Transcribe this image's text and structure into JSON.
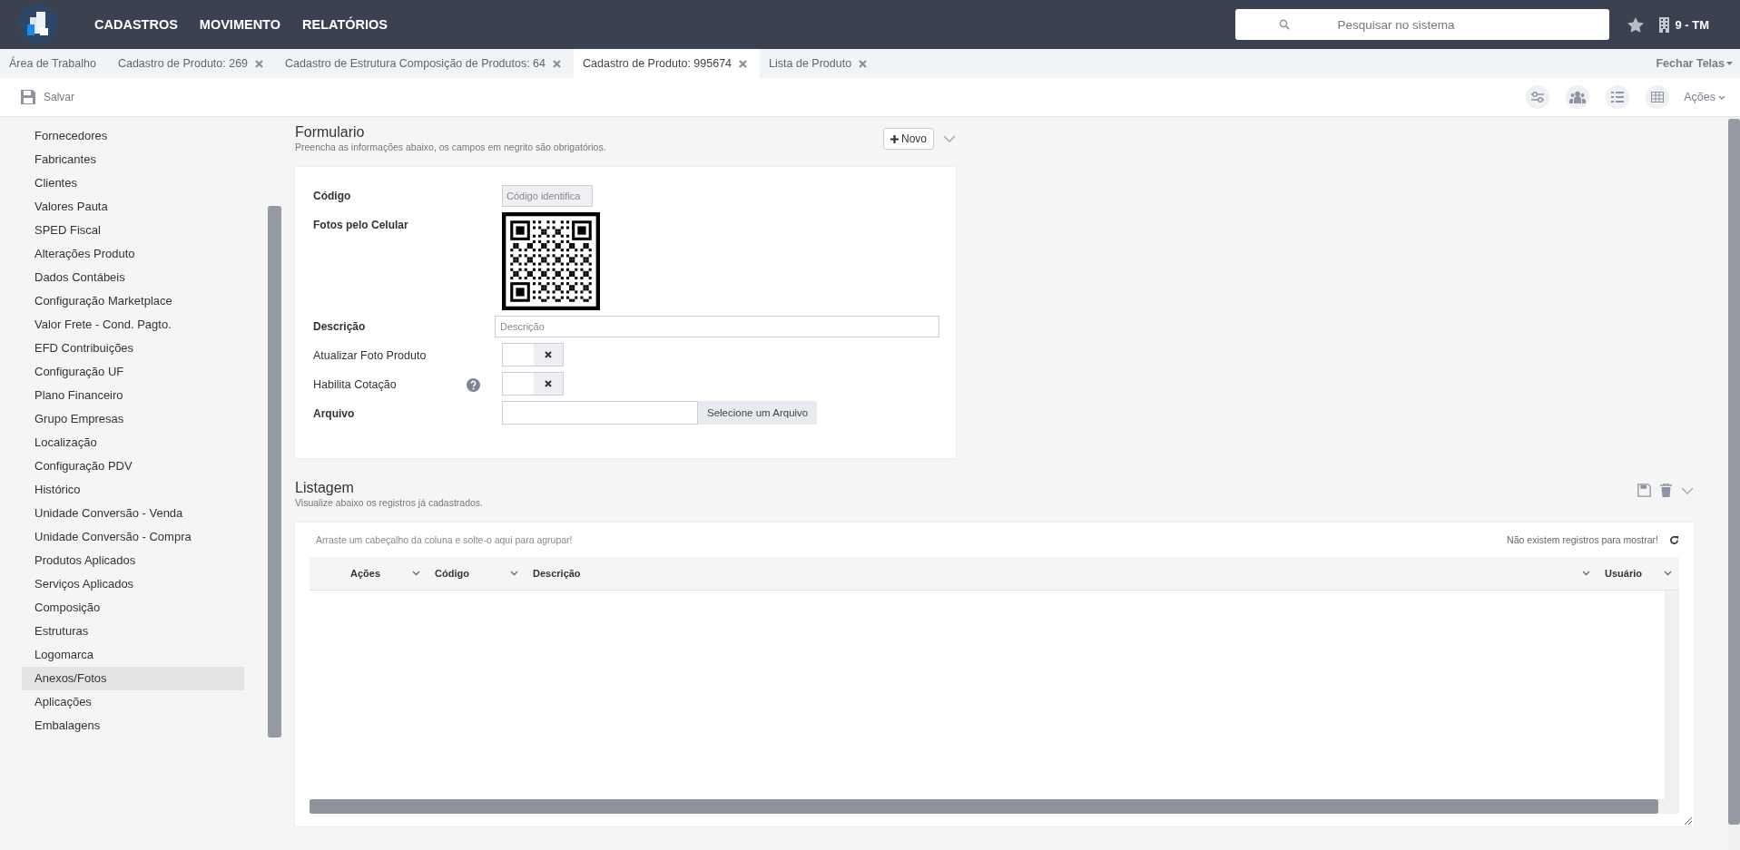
{
  "header": {
    "menu": [
      {
        "label": "CADASTROS"
      },
      {
        "label": "MOVIMENTO"
      },
      {
        "label": "RELATÓRIOS"
      }
    ],
    "search": {
      "placeholder": "Pesquisar no sistema"
    },
    "company": "9 - TM"
  },
  "tabs": [
    {
      "label": "Área de Trabalho",
      "selected": false,
      "closable": false
    },
    {
      "label": "Cadastro de Produto: 269",
      "selected": false,
      "closable": true
    },
    {
      "label": "Cadastro de Estrutura Composição de Produtos: 64",
      "selected": false,
      "closable": true
    },
    {
      "label": "Cadastro de Produto: 995674",
      "selected": true,
      "closable": true
    },
    {
      "label": "Lista de Produto",
      "selected": false,
      "closable": true
    }
  ],
  "close_screens": "Fechar Telas",
  "toolbar": {
    "save": "Salvar",
    "actions": "Ações"
  },
  "sidebar": {
    "items": [
      {
        "label": "Fornecedores",
        "selected": false
      },
      {
        "label": "Fabricantes",
        "selected": false
      },
      {
        "label": "Clientes",
        "selected": false
      },
      {
        "label": "Valores Pauta",
        "selected": false
      },
      {
        "label": "SPED Fiscal",
        "selected": false
      },
      {
        "label": "Alterações Produto",
        "selected": false
      },
      {
        "label": "Dados Contábeis",
        "selected": false
      },
      {
        "label": "Configuração Marketplace",
        "selected": false
      },
      {
        "label": "Valor Frete - Cond. Pagto.",
        "selected": false
      },
      {
        "label": "EFD Contribuições",
        "selected": false
      },
      {
        "label": "Configuração UF",
        "selected": false
      },
      {
        "label": "Plano Financeiro",
        "selected": false
      },
      {
        "label": "Grupo Empresas",
        "selected": false
      },
      {
        "label": "Localização",
        "selected": false
      },
      {
        "label": "Configuração PDV",
        "selected": false
      },
      {
        "label": "Histórico",
        "selected": false
      },
      {
        "label": "Unidade Conversão - Venda",
        "selected": false
      },
      {
        "label": "Unidade Conversão - Compra",
        "selected": false
      },
      {
        "label": "Produtos Aplicados",
        "selected": false
      },
      {
        "label": "Serviços Aplicados",
        "selected": false
      },
      {
        "label": "Composição",
        "selected": false
      },
      {
        "label": "Estruturas",
        "selected": false
      },
      {
        "label": "Logomarca",
        "selected": false
      },
      {
        "label": "Anexos/Fotos",
        "selected": true
      },
      {
        "label": "Aplicações",
        "selected": false
      },
      {
        "label": "Embalagens",
        "selected": false
      }
    ]
  },
  "form": {
    "title": "Formulario",
    "subtitle": "Preencha as informações abaixo, os campos em negrito são obrigatórios.",
    "new_button": "Novo",
    "fields": [
      {
        "kind": "text",
        "label": "Código",
        "required": true,
        "placeholder": "Código identifica",
        "short": true
      },
      {
        "kind": "qr",
        "label": "Fotos pelo Celular",
        "required": true
      },
      {
        "kind": "text",
        "label": "Descrição",
        "required": true,
        "placeholder": "Descrição",
        "short": false
      },
      {
        "kind": "toggle",
        "label": "Atualizar Foto Produto",
        "required": false,
        "checked": false,
        "help": false
      },
      {
        "kind": "toggle",
        "label": "Habilita Cotação",
        "required": false,
        "checked": false,
        "help": true
      },
      {
        "kind": "file",
        "label": "Arquivo",
        "required": true,
        "button": "Selecione um Arquivo"
      }
    ]
  },
  "listing": {
    "title": "Listagem",
    "subtitle": "Visualize abaixo os registros já cadastrados.",
    "group_hint": "Arraste um cabeçalho da coluna e solte-o aqui para agrupar!",
    "empty": "Não existem registros para mostrar!",
    "columns": [
      {
        "label": "Ações"
      },
      {
        "label": "Código"
      },
      {
        "label": "Descrição"
      },
      {
        "label": "Usuário"
      }
    ]
  }
}
